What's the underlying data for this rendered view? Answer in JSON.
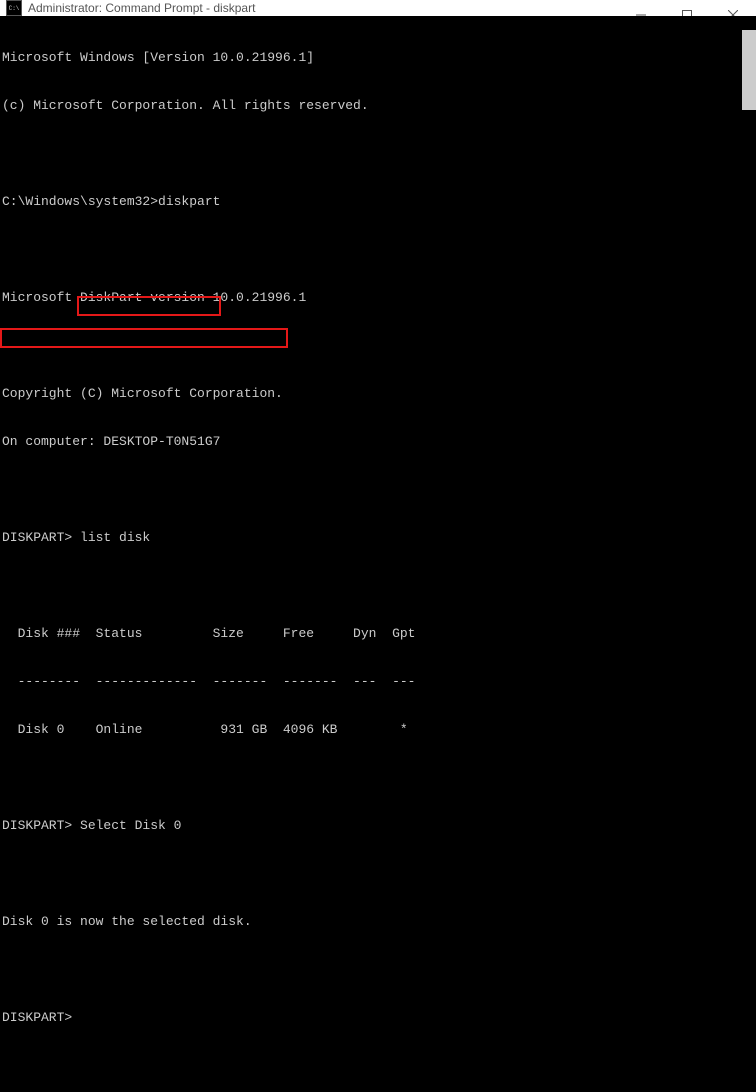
{
  "titlebar": {
    "title": "Administrator: Command Prompt - diskpart"
  },
  "terminal": {
    "lines": [
      "Microsoft Windows [Version 10.0.21996.1]",
      "(c) Microsoft Corporation. All rights reserved.",
      "",
      "C:\\Windows\\system32>diskpart",
      "",
      "Microsoft DiskPart version 10.0.21996.1",
      "",
      "Copyright (C) Microsoft Corporation.",
      "On computer: DESKTOP-T0N51G7",
      "",
      "DISKPART> list disk",
      "",
      "  Disk ###  Status         Size     Free     Dyn  Gpt",
      "  --------  -------------  -------  -------  ---  ---",
      "  Disk 0    Online          931 GB  4096 KB        *",
      "",
      "DISKPART> Select Disk 0",
      "",
      "Disk 0 is now the selected disk.",
      "",
      "DISKPART>"
    ]
  }
}
